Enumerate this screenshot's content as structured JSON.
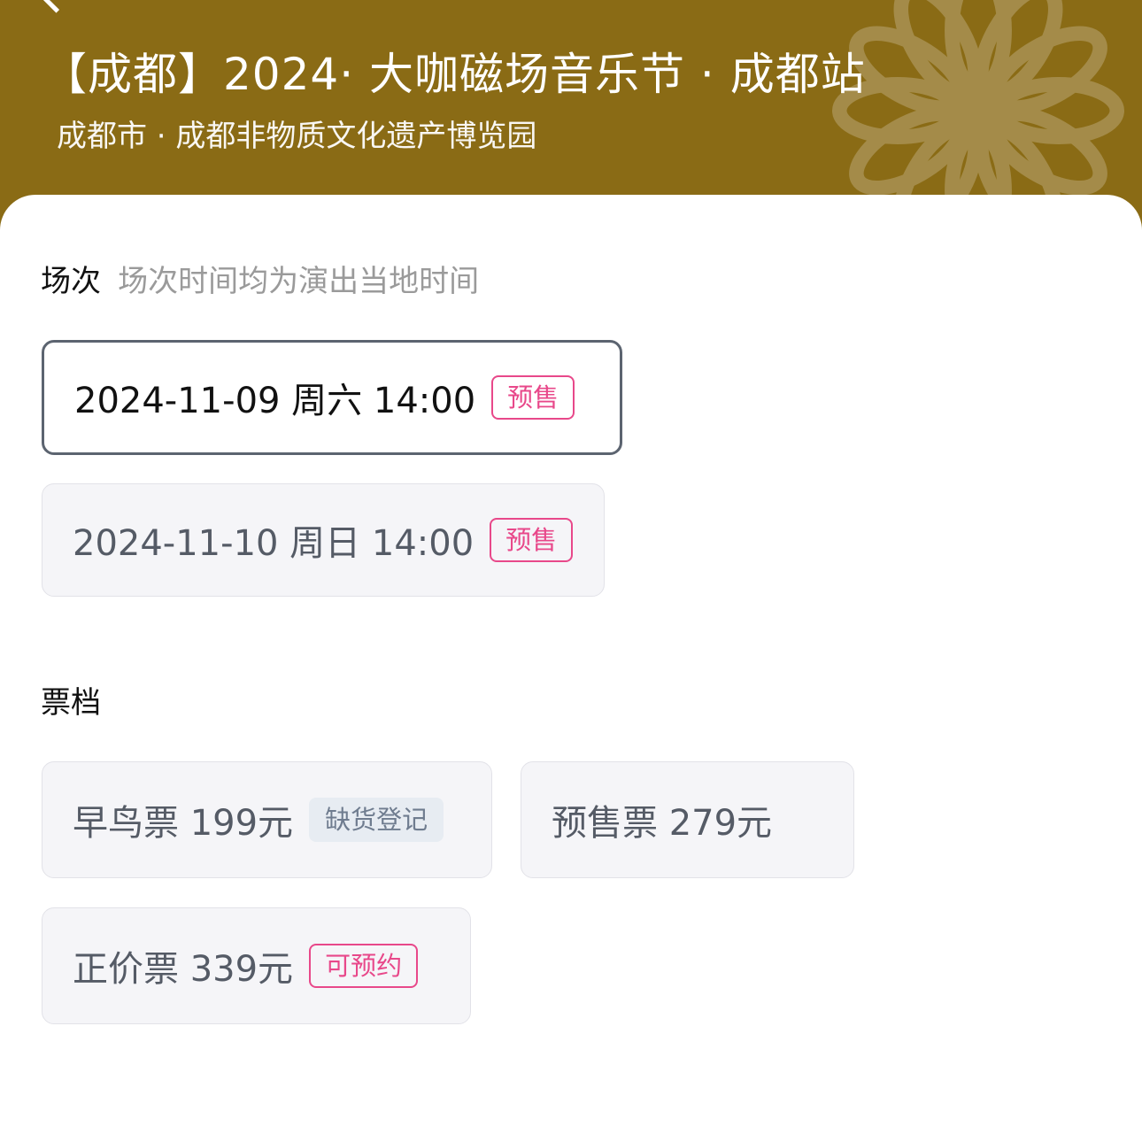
{
  "header": {
    "title": "【成都】2024· 大咖磁场音乐节 · 成都站",
    "venue": "成都市 · 成都非物质文化遗产博览园",
    "bg_color": "#8a6b15",
    "back_icon": "chevron-left-icon"
  },
  "sessions": {
    "title": "场次",
    "hint": "场次时间均为演出当地时间",
    "items": [
      {
        "label": "2024-11-09  周六 14:00",
        "badge": "预售",
        "selected": true
      },
      {
        "label": "2024-11-10 周日 14:00",
        "badge": "预售",
        "selected": false
      }
    ]
  },
  "tickets": {
    "title": "票档",
    "items": [
      {
        "label": "早鸟票 199元",
        "badge": "缺货登记"
      },
      {
        "label": "预售票 279元",
        "badge": ""
      },
      {
        "label": "正价票 339元",
        "badge": "可预约"
      }
    ]
  },
  "colors": {
    "accent_pink": "#e8488a",
    "selected_border": "#5c6470"
  }
}
